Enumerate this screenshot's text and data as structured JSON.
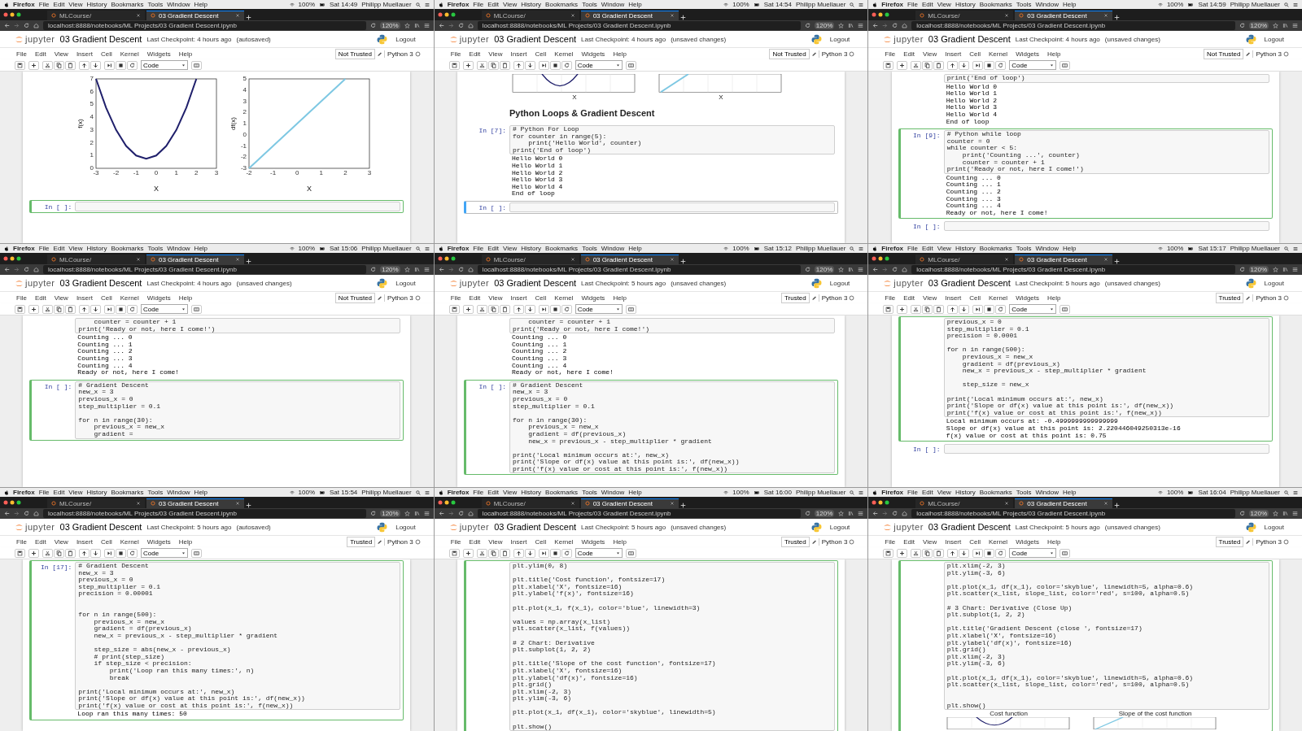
{
  "frames": [
    {
      "menubar": {
        "app": "Firefox",
        "menus": [
          "File",
          "Edit",
          "View",
          "History",
          "Bookmarks",
          "Tools",
          "Window",
          "Help"
        ],
        "battery": "100%",
        "clock": "Sat 14:49",
        "user": "Philipp Muellauer"
      },
      "tabs": [
        {
          "label": "MLCourse/",
          "selected": false
        },
        {
          "label": "03 Gradient Descent",
          "selected": true
        }
      ],
      "url": "localhost:8888/notebooks/ML Projects/03 Gradient Descent.ipynb",
      "zoom": "120%",
      "logo": "jupyter",
      "notebook_title": "03 Gradient Descent",
      "checkpoint": "Last Checkpoint: 4 hours ago",
      "save_status": "(autosaved)",
      "logout": "Logout",
      "menu": [
        "File",
        "Edit",
        "View",
        "Insert",
        "Cell",
        "Kernel",
        "Widgets",
        "Help"
      ],
      "trust": "Not Trusted",
      "kernel": "Python 3",
      "cell_type": "Code",
      "cells": [
        {
          "kind": "output",
          "selected": false,
          "editing": false,
          "charts": [
            {
              "chart_data": {
                "type": "line",
                "xlabel": "X",
                "ylabel": "f(x)",
                "x": [
                  -3,
                  -2.5,
                  -2,
                  -1.5,
                  -1,
                  -0.5,
                  0,
                  0.5,
                  1,
                  1.5,
                  2
                ],
                "series": [
                  {
                    "color": "#1f1f6b",
                    "values": [
                      7,
                      4.75,
                      3,
                      1.75,
                      1,
                      0.75,
                      1,
                      1.75,
                      3,
                      4.75,
                      7
                    ]
                  }
                ],
                "xlim": [
                  -3,
                  3
                ],
                "ylim": [
                  0,
                  7
                ],
                "xticks": [
                  -3,
                  -2,
                  -1,
                  0,
                  1,
                  2,
                  3
                ],
                "yticks": [
                  0,
                  1,
                  2,
                  3,
                  4,
                  5,
                  6,
                  7
                ]
              }
            },
            {
              "chart_data": {
                "type": "line",
                "xlabel": "X",
                "ylabel": "df(x)",
                "x": [
                  -2,
                  -1,
                  0,
                  1,
                  2
                ],
                "series": [
                  {
                    "color": "#7ec8e3",
                    "values": [
                      -3,
                      -1,
                      1,
                      3,
                      5
                    ]
                  }
                ],
                "xlim": [
                  -2,
                  3
                ],
                "ylim": [
                  -3,
                  5
                ],
                "xticks": [
                  -2,
                  -1,
                  0,
                  1,
                  2,
                  3
                ],
                "yticks": [
                  -3,
                  -2,
                  -1,
                  0,
                  1,
                  2,
                  3,
                  4,
                  5
                ]
              }
            }
          ]
        },
        {
          "kind": "code",
          "prompt": "In [ ]:",
          "selected": true,
          "editing": true
        }
      ]
    },
    {
      "menubar": {
        "app": "Firefox",
        "menus": [
          "File",
          "Edit",
          "View",
          "History",
          "Bookmarks",
          "Tools",
          "Window",
          "Help"
        ],
        "battery": "100%",
        "clock": "Sat 14:54",
        "user": "Philipp Muellauer"
      },
      "tabs": [
        {
          "label": "MLCourse/",
          "selected": false
        },
        {
          "label": "03 Gradient Descent",
          "selected": true
        }
      ],
      "url": "localhost:8888/notebooks/ML Projects/03 Gradient Descent.ipynb",
      "zoom": "120%",
      "logo": "jupyter",
      "notebook_title": "03 Gradient Descent",
      "checkpoint": "Last Checkpoint: 4 hours ago",
      "save_status": "(unsaved changes)",
      "logout": "Logout",
      "menu": [
        "File",
        "Edit",
        "View",
        "Insert",
        "Cell",
        "Kernel",
        "Widgets",
        "Help"
      ],
      "trust": "Not Trusted",
      "kernel": "Python 3",
      "cell_type": "Code",
      "cells": [
        {
          "kind": "output",
          "selected": false,
          "editing": false,
          "plots": [
            {
              "kind": "parabola",
              "xlabel": "X"
            },
            {
              "kind": "line",
              "xlabel": "X"
            }
          ]
        },
        {
          "kind": "markdown",
          "text": "Python Loops & Gradient Descent",
          "selected": false,
          "editing": false
        },
        {
          "kind": "code",
          "prompt": "In [7]:",
          "source": "# Python For Loop\nfor counter in range(5):\n    print('Hello World', counter)\nprint('End of loop')",
          "output": "Hello World 0\nHello World 1\nHello World 2\nHello World 3\nHello World 4\nEnd of loop",
          "selected": false,
          "editing": false
        },
        {
          "kind": "code",
          "prompt": "In [ ]:",
          "selected": true,
          "editing": false
        }
      ]
    },
    {
      "menubar": {
        "app": "Firefox",
        "menus": [
          "File",
          "Edit",
          "View",
          "History",
          "Bookmarks",
          "Tools",
          "Window",
          "Help"
        ],
        "battery": "100%",
        "clock": "Sat 14:59",
        "user": "Philipp Muellauer"
      },
      "tabs": [
        {
          "label": "MLCourse/",
          "selected": false
        },
        {
          "label": "03 Gradient Descent",
          "selected": true
        }
      ],
      "url": "localhost:8888/notebooks/ML Projects/03 Gradient Descent.ipynb",
      "zoom": "120%",
      "logo": "jupyter",
      "notebook_title": "03 Gradient Descent",
      "checkpoint": "Last Checkpoint: 4 hours ago",
      "save_status": "(unsaved changes)",
      "logout": "Logout",
      "menu": [
        "File",
        "Edit",
        "View",
        "Insert",
        "Cell",
        "Kernel",
        "Widgets",
        "Help"
      ],
      "trust": "Not Trusted",
      "kernel": "Python 3",
      "cell_type": "Code",
      "cells": [
        {
          "kind": "code",
          "source": "print('End of loop')",
          "output": "Hello World 0\nHello World 1\nHello World 2\nHello World 3\nHello World 4\nEnd of loop",
          "selected": false,
          "editing": false
        },
        {
          "kind": "code",
          "prompt": "In [9]:",
          "source": "# Python while loop\ncounter = 0\nwhile counter < 5:\n    print('Counting ...', counter)\n    counter = counter + 1\nprint('Ready or not, here I come!')",
          "output": "Counting ... 0\nCounting ... 1\nCounting ... 2\nCounting ... 3\nCounting ... 4\nReady or not, here I come!",
          "selected": true,
          "editing": true
        },
        {
          "kind": "code",
          "prompt": "In [ ]:",
          "selected": false,
          "editing": false
        }
      ]
    },
    {
      "menubar": {
        "app": "Firefox",
        "menus": [
          "File",
          "Edit",
          "View",
          "History",
          "Bookmarks",
          "Tools",
          "Window",
          "Help"
        ],
        "battery": "100%",
        "clock": "Sat 15:06",
        "user": "Philipp Muellauer"
      },
      "tabs": [
        {
          "label": "MLCourse/",
          "selected": false
        },
        {
          "label": "03 Gradient Descent",
          "selected": true
        }
      ],
      "url": "localhost:8888/notebooks/ML Projects/03 Gradient Descent.ipynb",
      "zoom": "120%",
      "logo": "jupyter",
      "notebook_title": "03 Gradient Descent",
      "checkpoint": "Last Checkpoint: 4 hours ago",
      "save_status": "(unsaved changes)",
      "logout": "Logout",
      "menu": [
        "File",
        "Edit",
        "View",
        "Insert",
        "Cell",
        "Kernel",
        "Widgets",
        "Help"
      ],
      "trust": "Not Trusted",
      "kernel": "Python 3",
      "cell_type": "Code",
      "cells": [
        {
          "kind": "code",
          "source": "    counter = counter + 1\nprint('Ready or not, here I come!')",
          "output": "Counting ... 0\nCounting ... 1\nCounting ... 2\nCounting ... 3\nCounting ... 4\nReady or not, here I come!",
          "selected": false,
          "editing": false
        },
        {
          "kind": "code",
          "prompt": "In [ ]:",
          "source": "# Gradient Descent\nnew_x = 3\nprevious_x = 0\nstep_multiplier = 0.1\n\nfor n in range(30):\n    previous_x = new_x\n    gradient =",
          "selected": true,
          "editing": true
        }
      ]
    },
    {
      "menubar": {
        "app": "Firefox",
        "menus": [
          "File",
          "Edit",
          "View",
          "History",
          "Bookmarks",
          "Tools",
          "Window",
          "Help"
        ],
        "battery": "100%",
        "clock": "Sat 15:12",
        "user": "Philipp Muellauer"
      },
      "tabs": [
        {
          "label": "MLCourse/",
          "selected": false
        },
        {
          "label": "03 Gradient Descent",
          "selected": true
        }
      ],
      "url": "localhost:8888/notebooks/ML Projects/03 Gradient Descent.ipynb",
      "zoom": "120%",
      "logo": "jupyter",
      "notebook_title": "03 Gradient Descent",
      "checkpoint": "Last Checkpoint: 5 hours ago",
      "save_status": "(unsaved changes)",
      "logout": "Logout",
      "menu": [
        "File",
        "Edit",
        "View",
        "Insert",
        "Cell",
        "Kernel",
        "Widgets",
        "Help"
      ],
      "trust": "Trusted",
      "kernel": "Python 3",
      "cell_type": "Code",
      "cells": [
        {
          "kind": "code",
          "source": "    counter = counter + 1\nprint('Ready or not, here I come!')",
          "output": "Counting ... 0\nCounting ... 1\nCounting ... 2\nCounting ... 3\nCounting ... 4\nReady or not, here I come!",
          "selected": false,
          "editing": false
        },
        {
          "kind": "code",
          "prompt": "In [ ]:",
          "source": "# Gradient Descent\nnew_x = 3\nprevious_x = 0\nstep_multiplier = 0.1\n\nfor n in range(30):\n    previous_x = new_x\n    gradient = df(previous_x)\n    new_x = previous_x - step_multiplier * gradient\n\nprint('Local minimum occurs at:', new_x)\nprint('Slope or df(x) value at this point is:', df(new_x))\nprint('f(x) value or cost at this point is:', f(new_x))",
          "selected": true,
          "editing": true
        }
      ]
    },
    {
      "menubar": {
        "app": "Firefox",
        "menus": [
          "File",
          "Edit",
          "View",
          "History",
          "Bookmarks",
          "Tools",
          "Window",
          "Help"
        ],
        "battery": "100%",
        "clock": "Sat 15:17",
        "user": "Philipp Muellauer"
      },
      "tabs": [
        {
          "label": "MLCourse/",
          "selected": false
        },
        {
          "label": "03 Gradient Descent",
          "selected": true
        }
      ],
      "url": "localhost:8888/notebooks/ML Projects/03 Gradient Descent.ipynb",
      "zoom": "120%",
      "logo": "jupyter",
      "notebook_title": "03 Gradient Descent",
      "checkpoint": "Last Checkpoint: 5 hours ago",
      "save_status": "(unsaved changes)",
      "logout": "Logout",
      "menu": [
        "File",
        "Edit",
        "View",
        "Insert",
        "Cell",
        "Kernel",
        "Widgets",
        "Help"
      ],
      "trust": "Trusted",
      "kernel": "Python 3",
      "cell_type": "Code",
      "cells": [
        {
          "kind": "code",
          "source": "previous_x = 0\nstep_multiplier = 0.1\nprecision = 0.0001\n\nfor n in range(500):\n    previous_x = new_x\n    gradient = df(previous_x)\n    new_x = previous_x - step_multiplier * gradient\n\n    step_size = new_x\n\nprint('Local minimum occurs at:', new_x)\nprint('Slope or df(x) value at this point is:', df(new_x))\nprint('f(x) value or cost at this point is:', f(new_x))",
          "output": "Local minimum occurs at: -0.4999999999999999\nSlope or df(x) value at this point is: 2.220446049250313e-16\nf(x) value or cost at this point is: 0.75",
          "selected": true,
          "editing": true
        },
        {
          "kind": "code",
          "prompt": "In [ ]:",
          "selected": false,
          "editing": false
        }
      ]
    },
    {
      "menubar": {
        "app": "Firefox",
        "menus": [
          "File",
          "Edit",
          "View",
          "History",
          "Bookmarks",
          "Tools",
          "Window",
          "Help"
        ],
        "battery": "100%",
        "clock": "Sat 15:54",
        "user": "Philipp Muellauer"
      },
      "tabs": [
        {
          "label": "MLCourse/",
          "selected": false
        },
        {
          "label": "03 Gradient Descent",
          "selected": true
        }
      ],
      "url": "localhost:8888/notebooks/ML Projects/03 Gradient Descent.ipynb",
      "zoom": "120%",
      "logo": "jupyter",
      "notebook_title": "03 Gradient Descent",
      "checkpoint": "Last Checkpoint: 5 hours ago",
      "save_status": "(autosaved)",
      "logout": "Logout",
      "menu": [
        "File",
        "Edit",
        "View",
        "Insert",
        "Cell",
        "Kernel",
        "Widgets",
        "Help"
      ],
      "trust": "Trusted",
      "kernel": "Python 3",
      "cell_type": "Code",
      "cells": [
        {
          "kind": "code",
          "prompt": "In [17]:",
          "source": "# Gradient Descent\nnew_x = 3\nprevious_x = 0\nstep_multiplier = 0.1\nprecision = 0.00001\n\n\nfor n in range(500):\n    previous_x = new_x\n    gradient = df(previous_x)\n    new_x = previous_x - step_multiplier * gradient\n\n    step_size = abs(new_x - previous_x)\n    # print(step_size)\n    if step_size < precision:\n        print('Loop ran this many times:', n)\n        break\n\nprint('Local minimum occurs at:', new_x)\nprint('Slope or df(x) value at this point is:', df(new_x))\nprint('f(x) value or cost at this point is:', f(new_x))",
          "output": "Loop ran this many times: 50",
          "selected": true,
          "editing": true
        }
      ]
    },
    {
      "menubar": {
        "app": "Firefox",
        "menus": [
          "File",
          "Edit",
          "View",
          "History",
          "Bookmarks",
          "Tools",
          "Window",
          "Help"
        ],
        "battery": "100%",
        "clock": "Sat 16:00",
        "user": "Philipp Muellauer"
      },
      "tabs": [
        {
          "label": "MLCourse/",
          "selected": false
        },
        {
          "label": "03 Gradient Descent",
          "selected": true
        }
      ],
      "url": "localhost:8888/notebooks/ML Projects/03 Gradient Descent.ipynb",
      "zoom": "120%",
      "logo": "jupyter",
      "notebook_title": "03 Gradient Descent",
      "checkpoint": "Last Checkpoint: 5 hours ago",
      "save_status": "(unsaved changes)",
      "logout": "Logout",
      "menu": [
        "File",
        "Edit",
        "View",
        "Insert",
        "Cell",
        "Kernel",
        "Widgets",
        "Help"
      ],
      "trust": "Trusted",
      "kernel": "Python 3",
      "cell_type": "Code",
      "cells": [
        {
          "kind": "code",
          "source": "plt.ylim(0, 8)\n\nplt.title('Cost function', fontsize=17)\nplt.xlabel('X', fontsize=16)\nplt.ylabel('f(x)', fontsize=16)\n\nplt.plot(x_1, f(x_1), color='blue', linewidth=3)\n\nvalues = np.array(x_list)\nplt.scatter(x_list, f(values))\n\n# 2 Chart: Derivative\nplt.subplot(1, 2, 2)\n\nplt.title('Slope of the cost function', fontsize=17)\nplt.xlabel('X', fontsize=16)\nplt.ylabel('df(x)', fontsize=16)\nplt.grid()\nplt.xlim(-2, 3)\nplt.ylim(-3, 6)\n\nplt.plot(x_1, df(x_1), color='skyblue', linewidth=5)\n\nplt.show()",
          "selected": true,
          "editing": true
        }
      ]
    },
    {
      "menubar": {
        "app": "Firefox",
        "menus": [
          "File",
          "Edit",
          "View",
          "History",
          "Bookmarks",
          "Tools",
          "Window",
          "Help"
        ],
        "battery": "100%",
        "clock": "Sat 16:04",
        "user": "Philipp Muellauer"
      },
      "tabs": [
        {
          "label": "MLCourse/",
          "selected": false
        },
        {
          "label": "03 Gradient Descent",
          "selected": true
        }
      ],
      "url": "localhost:8888/notebooks/ML Projects/03 Gradient Descent.ipynb",
      "zoom": "120%",
      "logo": "jupyter",
      "notebook_title": "03 Gradient Descent",
      "checkpoint": "Last Checkpoint: 5 hours ago",
      "save_status": "(unsaved changes)",
      "logout": "Logout",
      "menu": [
        "File",
        "Edit",
        "View",
        "Insert",
        "Cell",
        "Kernel",
        "Widgets",
        "Help"
      ],
      "trust": "Trusted",
      "kernel": "Python 3",
      "cell_type": "Code",
      "cells": [
        {
          "kind": "code",
          "source": "plt.xlim(-2, 3)\nplt.ylim(-3, 6)\n\nplt.plot(x_1, df(x_1), color='skyblue', linewidth=5, alpha=0.6)\nplt.scatter(x_list, slope_list, color='red', s=100, alpha=0.5)\n\n# 3 Chart: Derivative (Close Up)\nplt.subplot(1, 2, 2)\n\nplt.title('Gradient Descent (close ', fontsize=17)\nplt.xlabel('X', fontsize=16)\nplt.ylabel('df(x)', fontsize=16)\nplt.grid()\nplt.xlim(-2, 3)\nplt.ylim(-3, 6)\n\nplt.plot(x_1, df(x_1), color='skyblue', linewidth=5, alpha=0.6)\nplt.scatter(x_list, slope_list, color='red', s=100, alpha=0.5)\n\n\nplt.show()",
          "plots": [
            {
              "kind": "parabola",
              "title": "Cost function"
            },
            {
              "kind": "line",
              "title": "Slope of the cost function"
            }
          ],
          "selected": true,
          "editing": true
        }
      ]
    }
  ]
}
